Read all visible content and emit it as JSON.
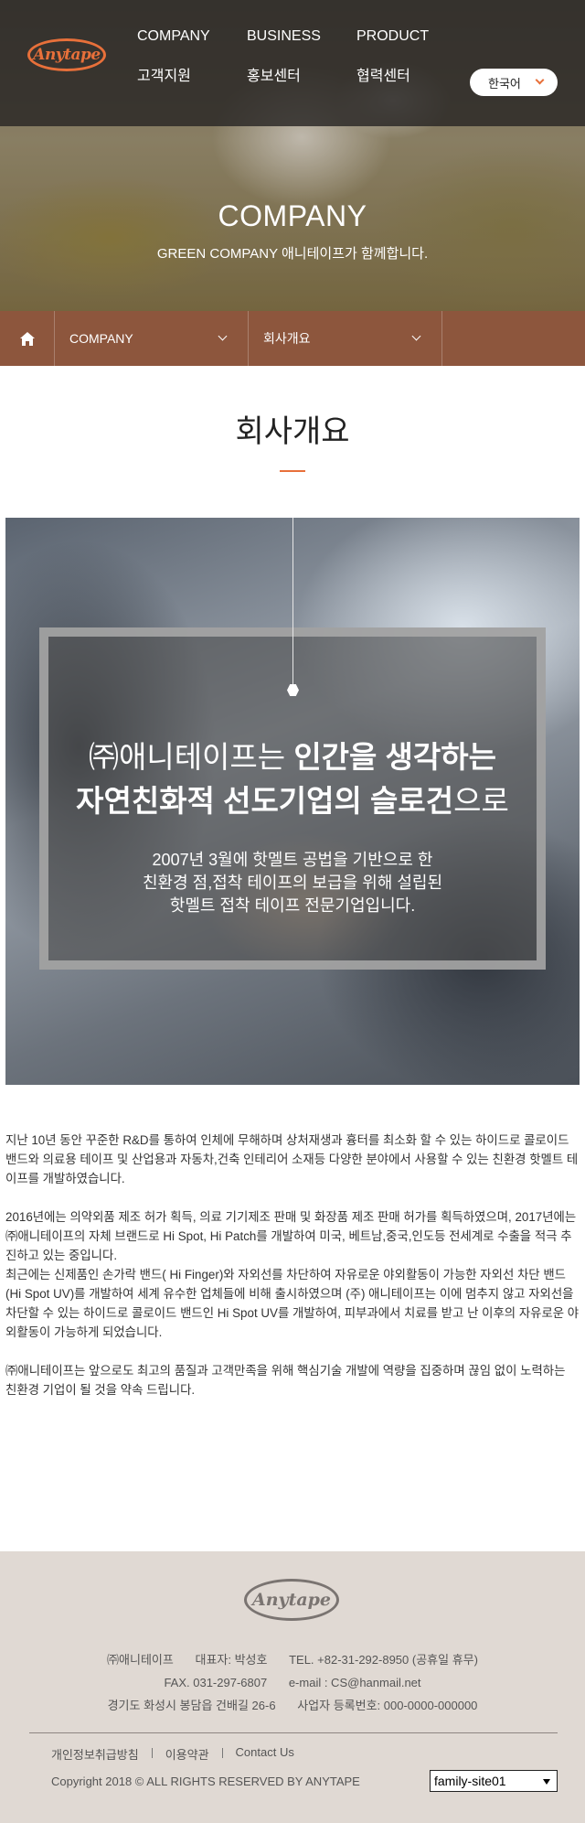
{
  "header": {
    "logo_text": "Anytape",
    "nav": [
      "COMPANY",
      "BUSINESS",
      "PRODUCT",
      "고객지원",
      "홍보센터",
      "협력센터"
    ],
    "language": "한국어"
  },
  "hero": {
    "title": "COMPANY",
    "subtitle": "GREEN COMPANY 애니테이프가 함께합니다."
  },
  "breadcrumb": {
    "home_icon": "home-icon",
    "level1": "COMPANY",
    "level2": "회사개요"
  },
  "main": {
    "title": "회사개요",
    "slogan_line1_light": "㈜애니테이프는 ",
    "slogan_line1_bold": "인간을 생각하는",
    "slogan_line2_bold": "자연친화적 선도기업의 슬로건",
    "slogan_line2_light": "으로",
    "slogan_desc": [
      "2007년 3월에 핫멜트 공법을 기반으로 한",
      "친환경 점,접착 테이프의 보급을 위해 설립된",
      "핫멜트 접착 테이프 전문기업입니다."
    ],
    "paragraphs": [
      "지난 10년 동안 꾸준한 R&D를 통하여 인체에 무해하며 상처재생과 흉터를 최소화 할 수 있는 하이드로 콜로이드 밴드와 의료용 테이프 및 산업용과 자동차,건축 인테리어 소재등 다양한 분야에서 사용할 수 있는 친환경 핫멜트 테이프를 개발하였습니다.",
      "2016년에는 의약외품 제조 허가 획득,  의료 기기제조 판매 및 화장품 제조 판매 허가를  획득하였으며, 2017년에는 ㈜애니테이프의 자체 브랜드로 Hi Spot, Hi Patch를 개발하여 미국, 베트남,중국,인도등 전세계로 수출을 적극 추진하고 있는 중입니다.",
      "최근에는 신제품인  손가락 밴드( Hi Finger)와 자외선를 차단하여 자유로운 야외활동이 가능한 자외선 차단 밴드 (Hi Spot UV)를 개발하여 세계 유수한 업체들에 비해  출시하였으며 (주) 애니테이프는 이에 멈추지 않고 자외선을 차단할 수 있는 하이드로 콜로이드 밴드인 Hi Spot UV를 개발하여, 피부과에서 치료를 받고 난 이후의 자유로운 야외활동이 가능하게 되었습니다.",
      "㈜애니테이프는 앞으로도 최고의 품질과 고객만족을 위해 핵심기술 개발에 역량을 집중하며 끊임 없이 노력하는 친환경 기업이 될 것을 약속 드립니다."
    ]
  },
  "footer": {
    "logo_text": "Anytape",
    "company": "㈜애니테이프",
    "ceo": "대표자: 박성호",
    "tel": "TEL. +82-31-292-8950 (공휴일 휴무)",
    "fax": "FAX. 031-297-6807",
    "email": "e-mail : CS@hanmail.net",
    "address": "경기도 화성시 봉담읍 건배길 26-6",
    "biz_no": "사업자 등록번호: 000-0000-000000",
    "links": [
      "개인정보취급방침",
      "이용약관",
      "Contact Us"
    ],
    "copyright": "Copyright 2018 © ALL RIGHTS RESERVED BY ANYTAPE",
    "family_site": "family-site01"
  },
  "colors": {
    "accent": "#e8703a",
    "breadcrumb_bg": "#8d563d",
    "footer_bg": "#e0d9d3"
  }
}
